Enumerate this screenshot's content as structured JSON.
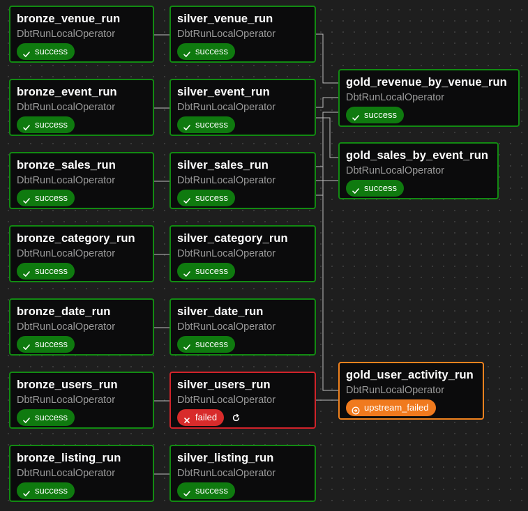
{
  "operator_label": "DbtRunLocalOperator",
  "status_labels": {
    "success": "success",
    "failed": "failed",
    "upstream_failed": "upstream_failed"
  },
  "colors": {
    "success": "#0f7a0f",
    "failed": "#d82b2b",
    "upstream_failed": "#f07a1e",
    "edge": "#bdbdbd"
  },
  "nodes": [
    {
      "id": "bronze_venue_run",
      "title": "bronze_venue_run",
      "status": "success"
    },
    {
      "id": "silver_venue_run",
      "title": "silver_venue_run",
      "status": "success"
    },
    {
      "id": "bronze_event_run",
      "title": "bronze_event_run",
      "status": "success"
    },
    {
      "id": "silver_event_run",
      "title": "silver_event_run",
      "status": "success"
    },
    {
      "id": "bronze_sales_run",
      "title": "bronze_sales_run",
      "status": "success"
    },
    {
      "id": "silver_sales_run",
      "title": "silver_sales_run",
      "status": "success"
    },
    {
      "id": "bronze_category_run",
      "title": "bronze_category_run",
      "status": "success"
    },
    {
      "id": "silver_category_run",
      "title": "silver_category_run",
      "status": "success"
    },
    {
      "id": "bronze_date_run",
      "title": "bronze_date_run",
      "status": "success"
    },
    {
      "id": "silver_date_run",
      "title": "silver_date_run",
      "status": "success"
    },
    {
      "id": "bronze_users_run",
      "title": "bronze_users_run",
      "status": "success"
    },
    {
      "id": "silver_users_run",
      "title": "silver_users_run",
      "status": "failed",
      "retry_icon": "refresh-icon"
    },
    {
      "id": "bronze_listing_run",
      "title": "bronze_listing_run",
      "status": "success"
    },
    {
      "id": "silver_listing_run",
      "title": "silver_listing_run",
      "status": "success"
    },
    {
      "id": "gold_revenue_by_venue_run",
      "title": "gold_revenue_by_venue_run",
      "status": "success"
    },
    {
      "id": "gold_sales_by_event_run",
      "title": "gold_sales_by_event_run",
      "status": "success"
    },
    {
      "id": "gold_user_activity_run",
      "title": "gold_user_activity_run",
      "status": "upstream_failed"
    }
  ],
  "edges": [
    [
      "bronze_venue_run",
      "silver_venue_run"
    ],
    [
      "bronze_event_run",
      "silver_event_run"
    ],
    [
      "bronze_sales_run",
      "silver_sales_run"
    ],
    [
      "bronze_category_run",
      "silver_category_run"
    ],
    [
      "bronze_date_run",
      "silver_date_run"
    ],
    [
      "bronze_users_run",
      "silver_users_run"
    ],
    [
      "bronze_listing_run",
      "silver_listing_run"
    ],
    [
      "silver_venue_run",
      "gold_revenue_by_venue_run"
    ],
    [
      "silver_event_run",
      "gold_revenue_by_venue_run"
    ],
    [
      "silver_sales_run",
      "gold_revenue_by_venue_run"
    ],
    [
      "silver_event_run",
      "gold_sales_by_event_run"
    ],
    [
      "silver_sales_run",
      "gold_sales_by_event_run"
    ],
    [
      "silver_event_run",
      "gold_user_activity_run"
    ],
    [
      "silver_sales_run",
      "gold_user_activity_run"
    ],
    [
      "silver_users_run",
      "gold_user_activity_run"
    ]
  ]
}
